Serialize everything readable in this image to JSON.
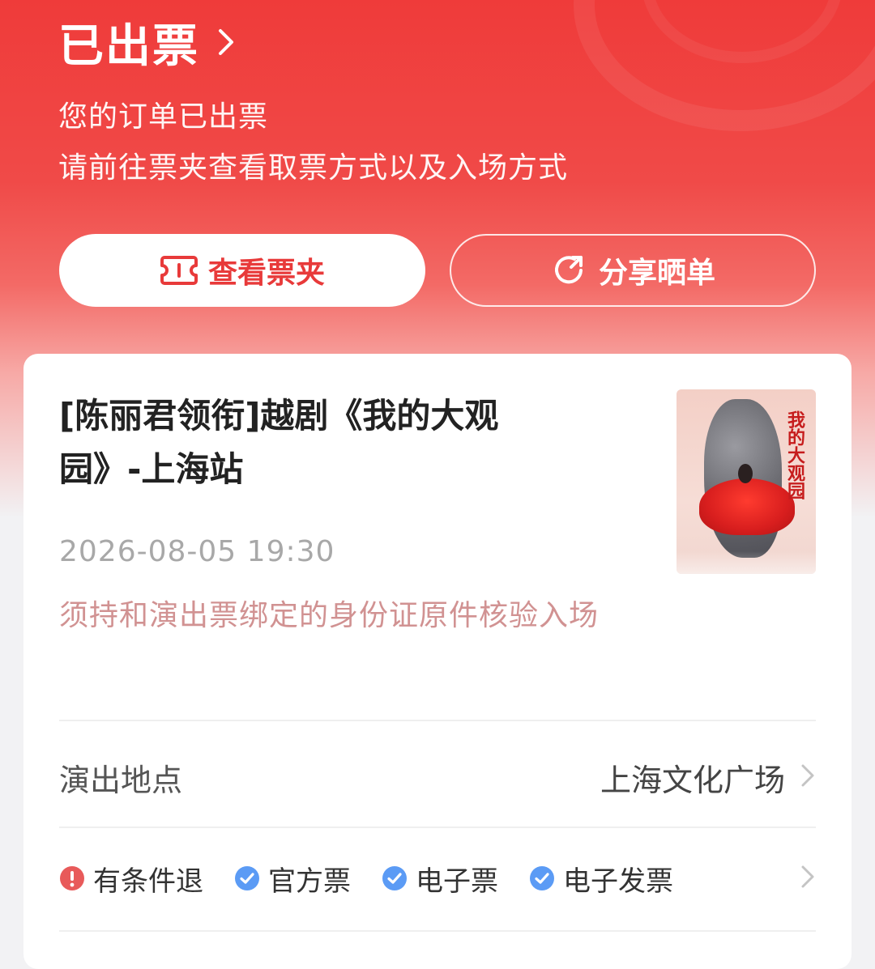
{
  "status": {
    "title": "已出票",
    "message_line1": "您的订单已出票",
    "message_line2": "请前往票夹查看取票方式以及入场方式"
  },
  "buttons": {
    "view_tickets": "查看票夹",
    "share": "分享晒单"
  },
  "show": {
    "title": "[陈丽君领衔]越剧《我的大观园》-上海站",
    "datetime": "2026-08-05 19:30",
    "id_note": "须持和演出票绑定的身份证原件核验入场",
    "poster_icon": "opera-poster-image"
  },
  "venue": {
    "label": "演出地点",
    "value": "上海文化广场"
  },
  "tags": [
    {
      "label": "有条件退",
      "icon": "exclamation-icon"
    },
    {
      "label": "官方票",
      "icon": "check-icon"
    },
    {
      "label": "电子票",
      "icon": "check-icon"
    },
    {
      "label": "电子发票",
      "icon": "check-icon"
    }
  ],
  "colors": {
    "brand_red": "#ef3b3a",
    "warning_red": "#e85a5a",
    "check_blue": "#5b9bf5",
    "note_pink": "#d19292"
  }
}
